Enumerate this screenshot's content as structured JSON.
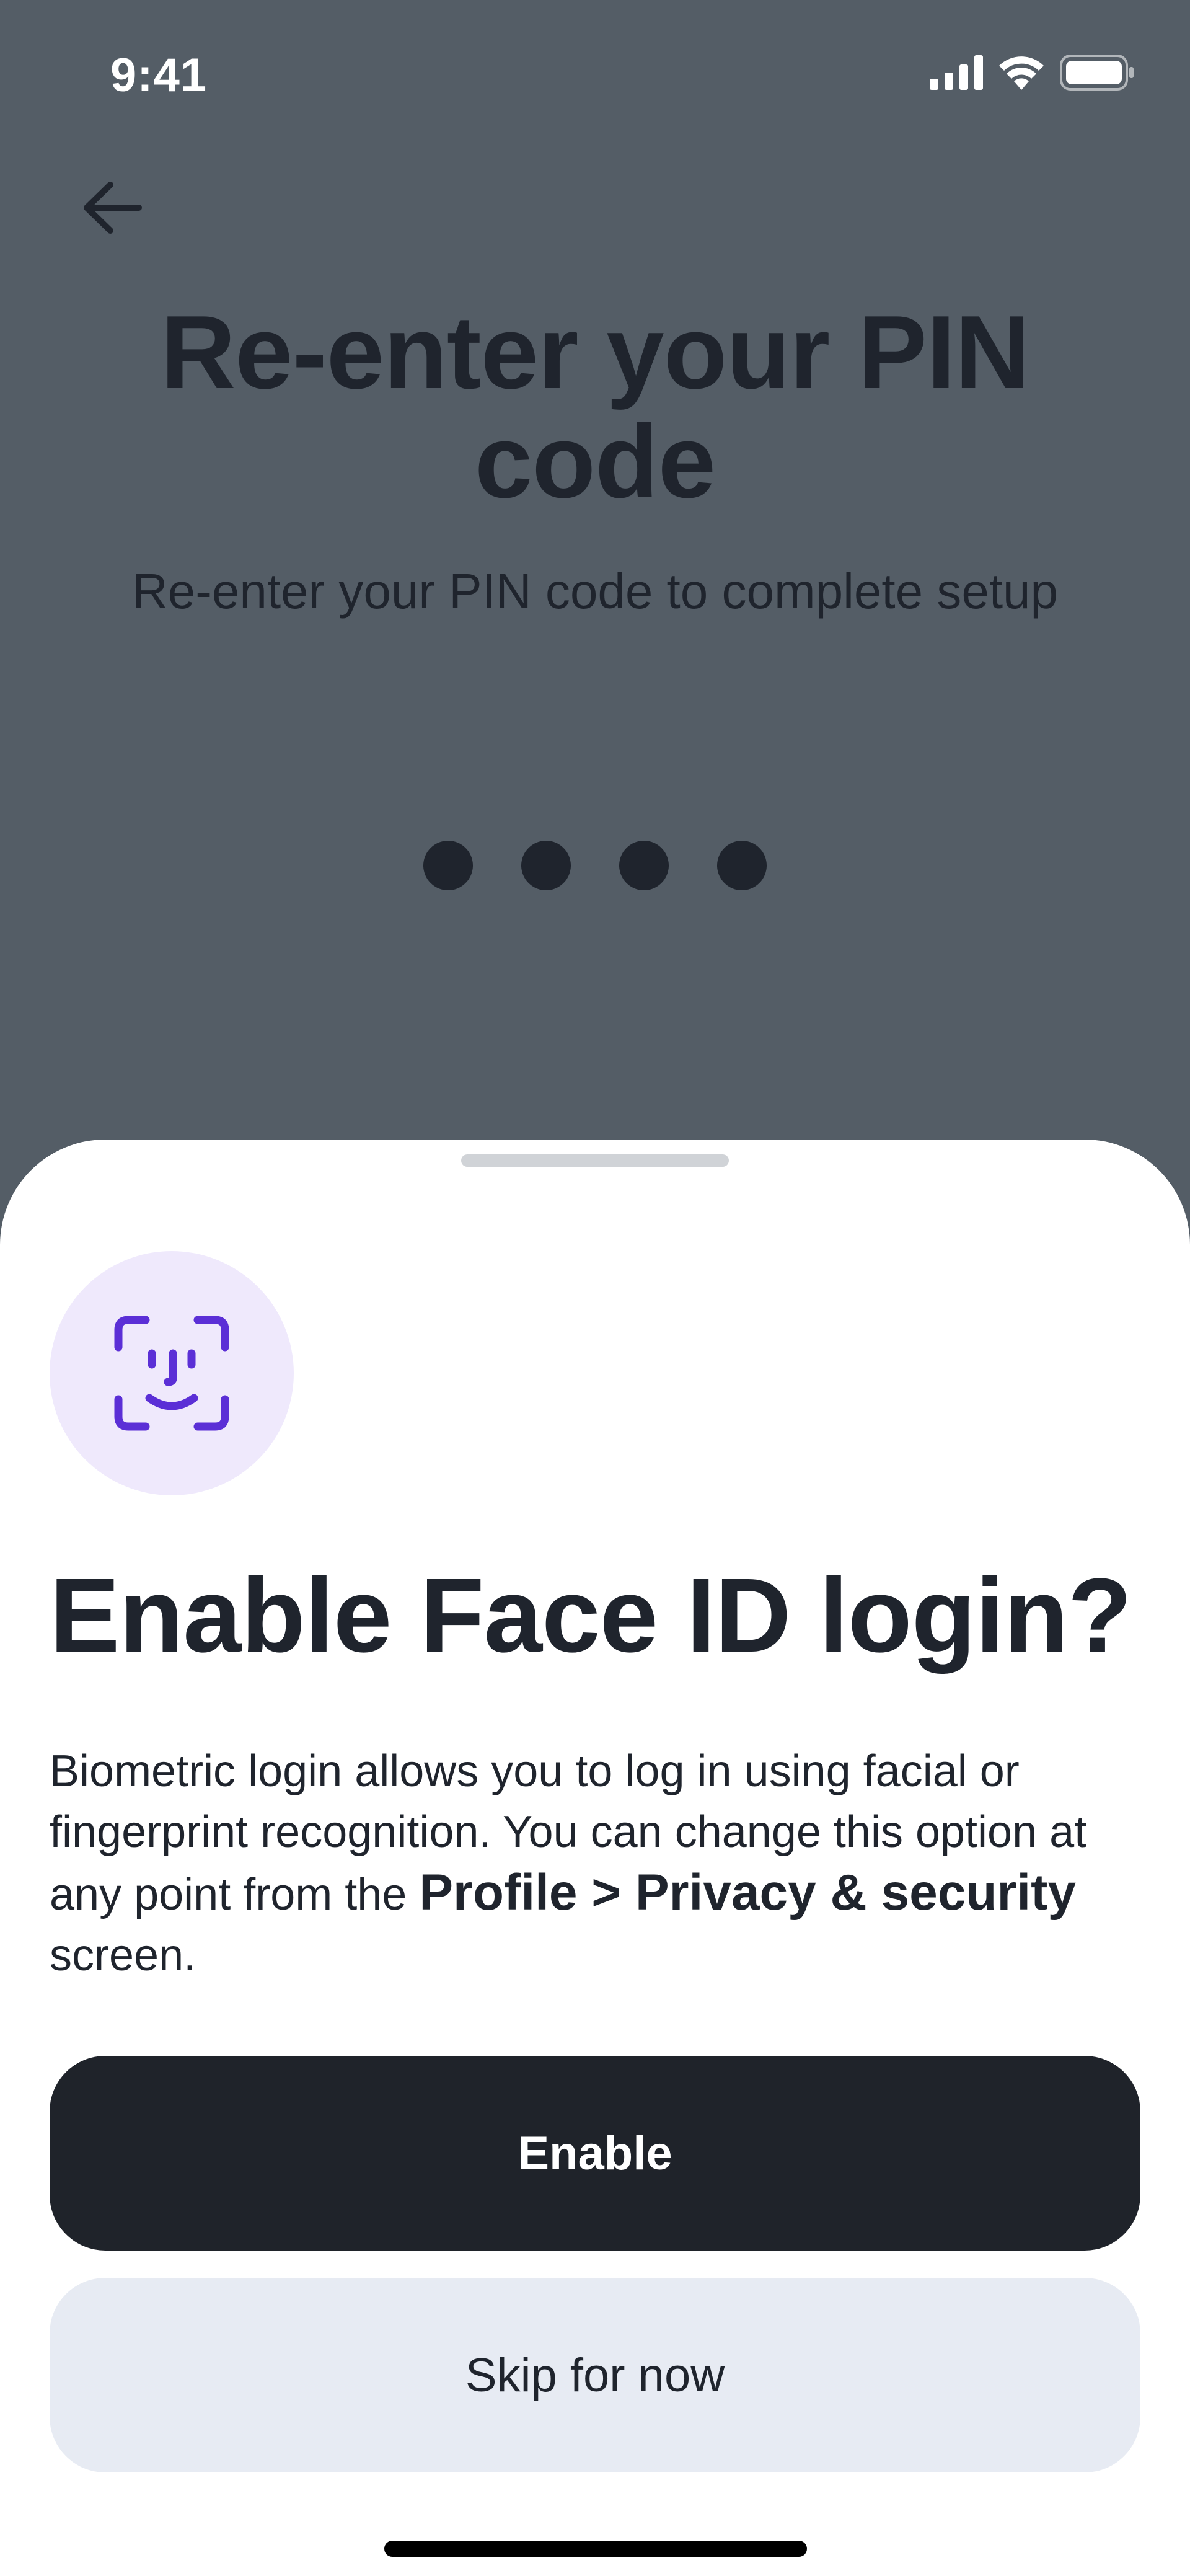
{
  "status_bar": {
    "time": "9:41",
    "icons": [
      "signal-icon",
      "wifi-icon",
      "battery-icon"
    ]
  },
  "header": {
    "back_icon": "arrow-left-icon",
    "title_line1": "Re-enter your PIN",
    "title_line2": "code",
    "subtitle": "Re-enter your PIN code to complete setup",
    "pin_entered": 4,
    "pin_length": 4
  },
  "sheet": {
    "icon": "face-id-icon",
    "title": "Enable Face ID login?",
    "body_part1": "Biometric login allows you to log in using facial or fingerprint recognition. You can change this option at any point from the ",
    "body_bold": "Profile > Privacy & security",
    "body_part2": " screen.",
    "enable_label": "Enable",
    "skip_label": "Skip for now"
  },
  "colors": {
    "overlay_bg": "#545d66",
    "text_dark": "#1f242d",
    "face_badge_bg": "#efe9fc",
    "face_icon": "#5b2fd6",
    "enable_bg": "#1f232a",
    "skip_bg": "#e7ebf3"
  }
}
